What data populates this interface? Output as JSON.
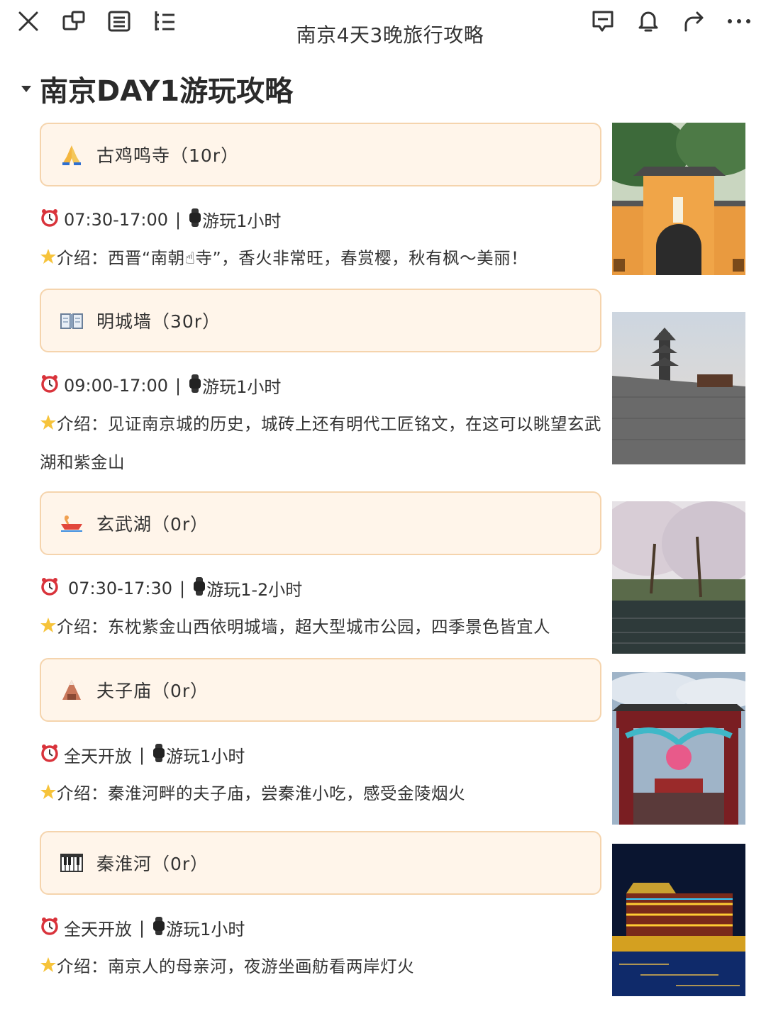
{
  "toolbar": {
    "title": "南京4天3晚旅行攻略",
    "icons": [
      "close-icon",
      "window-icon",
      "list-icon",
      "outline-icon",
      "comment-icon",
      "bell-icon",
      "share-icon",
      "more-icon"
    ]
  },
  "section": {
    "title": "南京DAY1游玩攻略"
  },
  "spots": [
    {
      "title": "古鸡鸣寺（10r）",
      "emoji": "pray-icon",
      "hours": "07:30-17:00",
      "duration": "游玩1小时",
      "intro": "介绍：西晋“南朝☝寺”，香火非常旺，春赏樱，秋有枫～美丽！",
      "photo": "temple-photo"
    },
    {
      "title": "明城墙（30r）",
      "emoji": "book-icon",
      "hours": "09:00-17:00",
      "duration": "游玩1小时",
      "intro": "介绍：见证南京城的历史，城砖上还有明代工匠铭文，在这可以眺望玄武湖和紫金山",
      "photo": "city-wall-photo"
    },
    {
      "title": "玄武湖（0r）",
      "emoji": "boat-icon",
      "hours": "07:30-17:30",
      "duration": "游玩1-2小时",
      "intro": "介绍：东枕紫金山西依明城墙，超大型城市公园，四季景色皆宜人",
      "photo": "lake-photo"
    },
    {
      "title": "夫子庙（0r）",
      "emoji": "mountain-icon",
      "hours": "全天开放",
      "duration": "游玩1小时",
      "intro": "介绍：秦淮河畔的夫子庙，尝秦淮小吃，感受金陵烟火",
      "photo": "confucius-temple-photo"
    },
    {
      "title": "秦淮河（0r）",
      "emoji": "piano-icon",
      "hours": "全天开放",
      "duration": "游玩1小时",
      "intro": "介绍：南京人的母亲河，夜游坐画舫看两岸灯火",
      "photo": "river-night-photo"
    }
  ],
  "colors": {
    "card_bg": "#fff5ea",
    "card_border": "#f5d4ad",
    "text": "#333333"
  }
}
